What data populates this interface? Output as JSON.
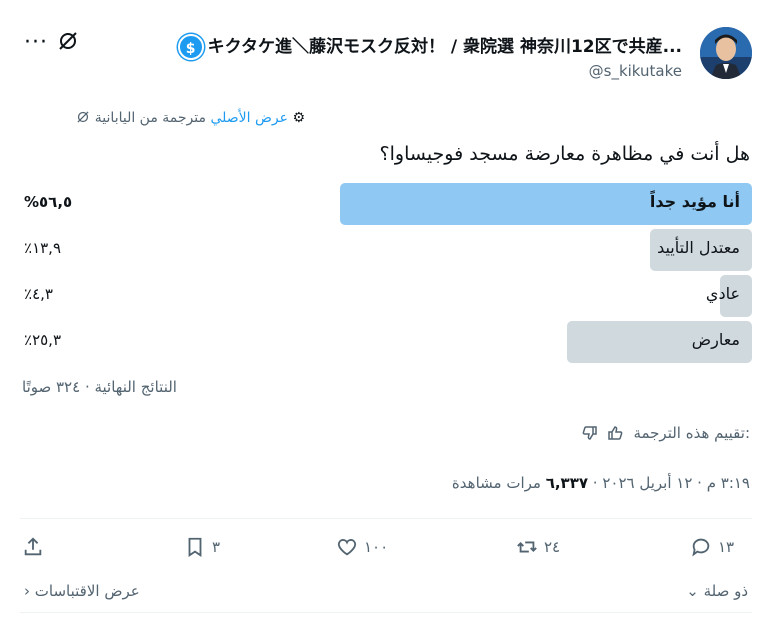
{
  "header": {
    "more_glyph": "···",
    "display_name": "キクタケ進＼藤沢モスク反対！ / 衆院選 神奈川12区で共産...",
    "handle": "@s_kikutake",
    "verified_glyph": "$"
  },
  "translation": {
    "show_original": "عرض الأصلي",
    "translated_from": "مترجمة من اليابانية"
  },
  "question": "هل أنت في مظاهرة معارضة مسجد فوجيساوا؟",
  "poll": {
    "options": [
      {
        "label": "أنا مؤيد جداً",
        "percent_text": "%٥٦,٥",
        "share": 56.5,
        "winner": true
      },
      {
        "label": "معتدل التأييد",
        "percent_text": "٪١٣,٩",
        "share": 13.9,
        "winner": false
      },
      {
        "label": "عادي",
        "percent_text": "٪٤,٣",
        "share": 4.3,
        "winner": false
      },
      {
        "label": "معارض",
        "percent_text": "٪٢٥,٣",
        "share": 25.3,
        "winner": false
      }
    ],
    "results_text": "النتائج النهائية · ٣٢٤ صوتًا"
  },
  "rate_translation": ":تقييم هذه الترجمة",
  "meta": {
    "time_date": "٣:١٩ م · ١٢ أبريل ٢٠٢٦ · ",
    "views_count": "٦,٣٣٧",
    "views_label": "مرات مشاهدة"
  },
  "actions": {
    "replies": "١٣",
    "retweets": "٢٤",
    "likes": "١٠٠",
    "bookmarks": "٣"
  },
  "footer": {
    "related": "ذو صلة",
    "quotes": "عرض الاقتباسات"
  }
}
